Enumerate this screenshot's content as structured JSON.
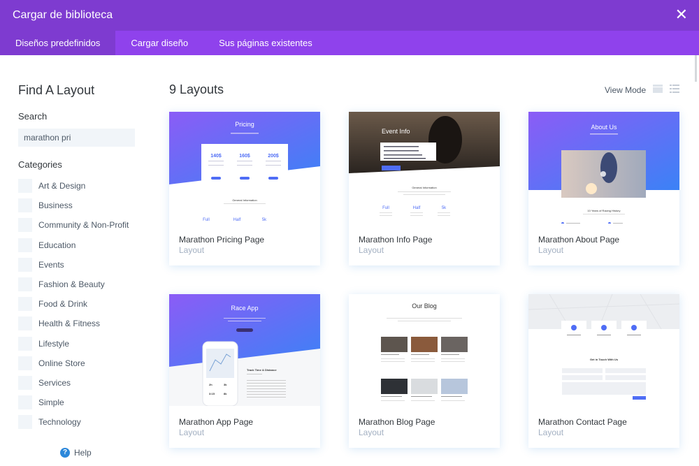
{
  "header": {
    "title": "Cargar de biblioteca",
    "close_glyph": "✕"
  },
  "tabs": [
    {
      "label": "Diseños predefinidos",
      "active": true
    },
    {
      "label": "Cargar diseño",
      "active": false
    },
    {
      "label": "Sus páginas existentes",
      "active": false
    }
  ],
  "sidebar": {
    "title": "Find A Layout",
    "search_label": "Search",
    "search_value": "marathon pri",
    "categories_label": "Categories",
    "categories": [
      "Art & Design",
      "Business",
      "Community & Non-Profit",
      "Education",
      "Events",
      "Fashion & Beauty",
      "Food & Drink",
      "Health & Fitness",
      "Lifestyle",
      "Online Store",
      "Services",
      "Simple",
      "Technology"
    ],
    "help_label": "Help"
  },
  "main": {
    "count": "9 Layouts",
    "view_mode_label": "View Mode",
    "cards": [
      {
        "name": "Marathon Pricing Page",
        "type": "Layout",
        "thumb": {
          "title": "Pricing",
          "prices": [
            "140$",
            "160$",
            "200$"
          ],
          "info": "General Information",
          "stats": [
            "Full",
            "Half",
            "5k"
          ]
        }
      },
      {
        "name": "Marathon Info Page",
        "type": "Layout",
        "thumb": {
          "title": "Event Info",
          "info": "General Information",
          "stats": [
            "Full",
            "Half",
            "5k"
          ]
        }
      },
      {
        "name": "Marathon About Page",
        "type": "Layout",
        "thumb": {
          "title": "About Us",
          "sub": "10 Years of Racing History"
        }
      },
      {
        "name": "Marathon App Page",
        "type": "Layout",
        "thumb": {
          "title": "Race App",
          "sub": "Track Time & Distance",
          "phone_stats": [
            "2h",
            "3k",
            "3:15",
            "8k"
          ]
        }
      },
      {
        "name": "Marathon Blog Page",
        "type": "Layout",
        "thumb": {
          "title": "Our Blog"
        }
      },
      {
        "name": "Marathon Contact Page",
        "type": "Layout",
        "thumb": {
          "sub": "Get in Touch With Us"
        }
      }
    ]
  },
  "colors": {
    "header": "#7e3bd0",
    "tabs": "#8f42ec",
    "accent": "#2b87da"
  }
}
